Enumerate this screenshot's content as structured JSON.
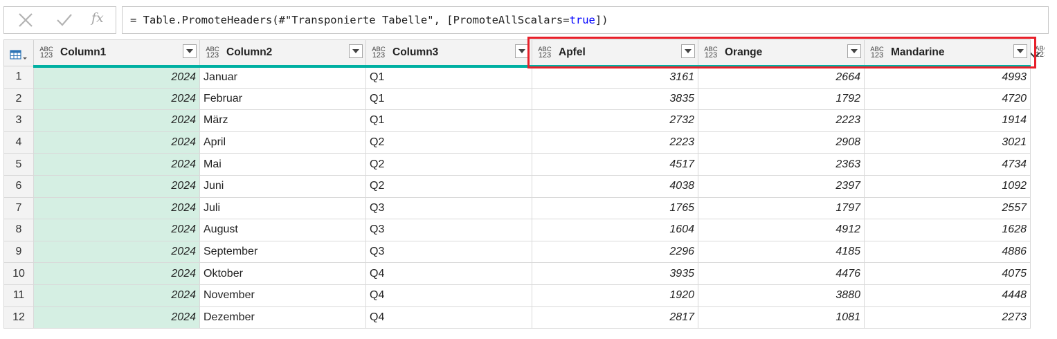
{
  "formula_bar": {
    "cancel_icon": "close-icon",
    "confirm_icon": "checkmark-icon",
    "fx_label": "fx",
    "formula_prefix": "= Table.PromoteHeaders(#\"Transponierte Tabelle\", [PromoteAllScalars=",
    "formula_keyword": "true",
    "formula_suffix": "])",
    "expand_icon": "chevron-down-icon"
  },
  "grid": {
    "type_icon_top": "ABC",
    "type_icon_bottom": "123",
    "columns": [
      {
        "label": "Column1"
      },
      {
        "label": "Column2"
      },
      {
        "label": "Column3"
      },
      {
        "label": "Apfel"
      },
      {
        "label": "Orange"
      },
      {
        "label": "Mandarine"
      }
    ],
    "rows": [
      {
        "n": "1",
        "c1": "2024",
        "c2": "Januar",
        "c3": "Q1",
        "c4": "3161",
        "c5": "2664",
        "c6": "4993"
      },
      {
        "n": "2",
        "c1": "2024",
        "c2": "Februar",
        "c3": "Q1",
        "c4": "3835",
        "c5": "1792",
        "c6": "4720"
      },
      {
        "n": "3",
        "c1": "2024",
        "c2": "März",
        "c3": "Q1",
        "c4": "2732",
        "c5": "2223",
        "c6": "1914"
      },
      {
        "n": "4",
        "c1": "2024",
        "c2": "April",
        "c3": "Q2",
        "c4": "2223",
        "c5": "2908",
        "c6": "3021"
      },
      {
        "n": "5",
        "c1": "2024",
        "c2": "Mai",
        "c3": "Q2",
        "c4": "4517",
        "c5": "2363",
        "c6": "4734"
      },
      {
        "n": "6",
        "c1": "2024",
        "c2": "Juni",
        "c3": "Q2",
        "c4": "4038",
        "c5": "2397",
        "c6": "1092"
      },
      {
        "n": "7",
        "c1": "2024",
        "c2": "Juli",
        "c3": "Q3",
        "c4": "1765",
        "c5": "1797",
        "c6": "2557"
      },
      {
        "n": "8",
        "c1": "2024",
        "c2": "August",
        "c3": "Q3",
        "c4": "1604",
        "c5": "4912",
        "c6": "1628"
      },
      {
        "n": "9",
        "c1": "2024",
        "c2": "September",
        "c3": "Q3",
        "c4": "2296",
        "c5": "4185",
        "c6": "4886"
      },
      {
        "n": "10",
        "c1": "2024",
        "c2": "Oktober",
        "c3": "Q4",
        "c4": "3935",
        "c5": "4476",
        "c6": "4075"
      },
      {
        "n": "11",
        "c1": "2024",
        "c2": "November",
        "c3": "Q4",
        "c4": "1920",
        "c5": "3880",
        "c6": "4448"
      },
      {
        "n": "12",
        "c1": "2024",
        "c2": "Dezember",
        "c3": "Q4",
        "c4": "2817",
        "c5": "1081",
        "c6": "2273"
      }
    ]
  },
  "colors": {
    "accent_teal": "#00b0a2",
    "selected_column": "#d5efe3",
    "highlight_red": "#e8202a"
  }
}
